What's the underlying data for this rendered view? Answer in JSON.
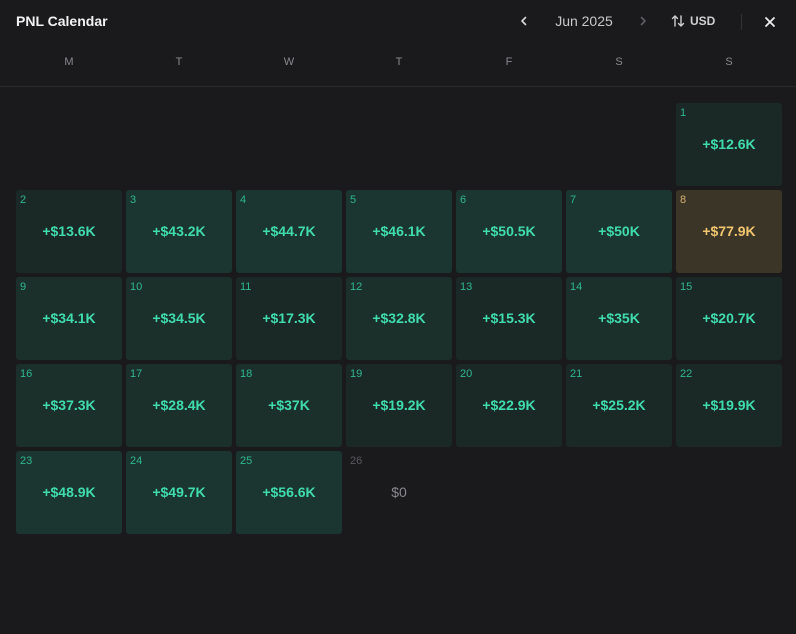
{
  "header": {
    "title": "PNL Calendar",
    "month_label": "Jun 2025",
    "currency_label": "USD",
    "icons": {
      "prev": "chevron-left-icon",
      "next": "chevron-right-icon",
      "sort": "sort-arrows-icon",
      "close": "close-icon"
    }
  },
  "weekdays": [
    "M",
    "T",
    "W",
    "T",
    "F",
    "S",
    "S"
  ],
  "colors": {
    "background": "#1a1a1c",
    "profit_text": "#3fdcae",
    "best_day_text": "#f2c66e",
    "best_day_bg": "#3b3528",
    "day_number": "#2fb890"
  },
  "calendar": {
    "leading_empty": 6,
    "days": [
      {
        "day": "1",
        "pnl": "+$12.6K",
        "tier": "low"
      },
      {
        "day": "2",
        "pnl": "+$13.6K",
        "tier": "low"
      },
      {
        "day": "3",
        "pnl": "+$43.2K",
        "tier": "high"
      },
      {
        "day": "4",
        "pnl": "+$44.7K",
        "tier": "high"
      },
      {
        "day": "5",
        "pnl": "+$46.1K",
        "tier": "high"
      },
      {
        "day": "6",
        "pnl": "+$50.5K",
        "tier": "high"
      },
      {
        "day": "7",
        "pnl": "+$50K",
        "tier": "high"
      },
      {
        "day": "8",
        "pnl": "+$77.9K",
        "tier": "best"
      },
      {
        "day": "9",
        "pnl": "+$34.1K",
        "tier": "mid"
      },
      {
        "day": "10",
        "pnl": "+$34.5K",
        "tier": "mid"
      },
      {
        "day": "11",
        "pnl": "+$17.3K",
        "tier": "low"
      },
      {
        "day": "12",
        "pnl": "+$32.8K",
        "tier": "mid"
      },
      {
        "day": "13",
        "pnl": "+$15.3K",
        "tier": "low"
      },
      {
        "day": "14",
        "pnl": "+$35K",
        "tier": "mid"
      },
      {
        "day": "15",
        "pnl": "+$20.7K",
        "tier": "low"
      },
      {
        "day": "16",
        "pnl": "+$37.3K",
        "tier": "mid"
      },
      {
        "day": "17",
        "pnl": "+$28.4K",
        "tier": "mid"
      },
      {
        "day": "18",
        "pnl": "+$37K",
        "tier": "mid"
      },
      {
        "day": "19",
        "pnl": "+$19.2K",
        "tier": "low"
      },
      {
        "day": "20",
        "pnl": "+$22.9K",
        "tier": "low"
      },
      {
        "day": "21",
        "pnl": "+$25.2K",
        "tier": "low"
      },
      {
        "day": "22",
        "pnl": "+$19.9K",
        "tier": "low"
      },
      {
        "day": "23",
        "pnl": "+$48.9K",
        "tier": "high"
      },
      {
        "day": "24",
        "pnl": "+$49.7K",
        "tier": "high"
      },
      {
        "day": "25",
        "pnl": "+$56.6K",
        "tier": "high"
      },
      {
        "day": "26",
        "pnl": "$0",
        "tier": "zero"
      }
    ]
  }
}
